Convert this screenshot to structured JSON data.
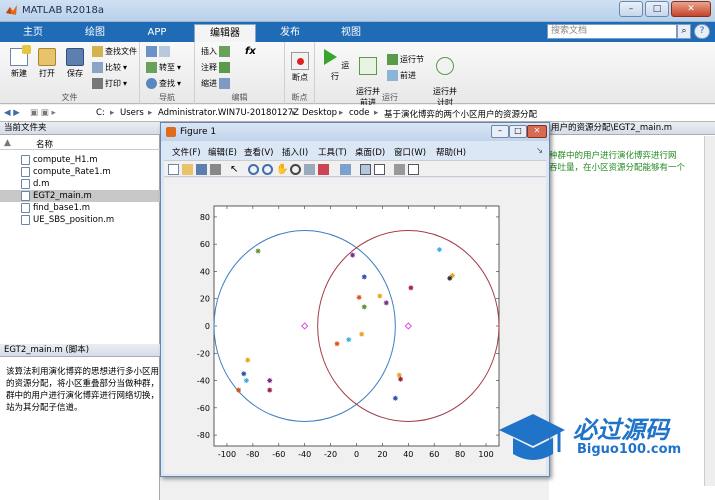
{
  "window": {
    "title": "MATLAB R2018a",
    "min": "–",
    "max": "□",
    "close": "✕"
  },
  "ribbon_tabs": [
    {
      "label": "主页"
    },
    {
      "label": "绘图"
    },
    {
      "label": "APP"
    },
    {
      "label": "编辑器"
    },
    {
      "label": "发布"
    },
    {
      "label": "视图"
    }
  ],
  "search": {
    "placeholder": "搜索文档",
    "help": "?"
  },
  "ribbon": {
    "file_group": {
      "label": "文件",
      "new": "新建",
      "open": "打开",
      "save": "保存",
      "find_files": "查找文件",
      "compare": "比较",
      "print": "打印"
    },
    "nav_group": {
      "label": "导航",
      "goto": "转至",
      "find": "查找"
    },
    "edit_group": {
      "label": "编辑",
      "insert": "插入",
      "comment": "注释",
      "indent": "缩进",
      "fx": "fx"
    },
    "breakpoint_group": {
      "label": "断点",
      "breakpoint": "断点"
    },
    "run_group": {
      "label": "运行",
      "run": "运行",
      "run_advance": "运行并\n前进",
      "run_section": "运行节",
      "advance": "前进",
      "run_time": "运行并\n计时"
    }
  },
  "address": {
    "path": [
      "C:",
      "Users",
      "Administrator.WIN7U-20180127Z",
      "Desktop",
      "code",
      "基于演化博弈的两个小区用户的资源分配"
    ]
  },
  "current_folder": {
    "header": "当前文件夹",
    "col_name": "名称",
    "sort": "▲",
    "files": [
      "compute_H1.m",
      "compute_Rate1.m",
      "d.m",
      "EGT2_main.m",
      "find_base1.m",
      "UE_SBS_position.m"
    ],
    "selected": "EGT2_main.m"
  },
  "details": {
    "header": "EGT2_main.m (脚本)",
    "text": [
      "该算法利用演化博弈的思想进行多小区用",
      "的资源分配，将小区重叠部分当做种群，",
      "群中的用户进行演化博弈进行网络切换，",
      "站为其分配子信道。"
    ]
  },
  "editor": {
    "tab": "用户的资源分配\\EGT2_main.m",
    "lines": [
      "种群中的用户进行演化博弈进行网",
      "吞吐量，在小区资源分配能够有一个"
    ]
  },
  "figure": {
    "title": "Figure 1",
    "menu": [
      "文件(F)",
      "编辑(E)",
      "查看(V)",
      "插入(I)",
      "工具(T)",
      "桌面(D)",
      "窗口(W)",
      "帮助(H)"
    ]
  },
  "chart_data": {
    "type": "scatter",
    "xlim": [
      -110,
      110
    ],
    "ylim": [
      -88,
      88
    ],
    "xticks": [
      -100,
      -80,
      -60,
      -40,
      -20,
      0,
      20,
      40,
      60,
      80,
      100
    ],
    "yticks": [
      80,
      60,
      40,
      20,
      0,
      -20,
      -40,
      -60,
      -80
    ],
    "circles": [
      {
        "cx": -40,
        "cy": 0,
        "r": 70,
        "color": "#3a7fc1"
      },
      {
        "cx": 40,
        "cy": 0,
        "r": 70,
        "color": "#a23b4a"
      }
    ],
    "centers": [
      {
        "x": -40,
        "y": 0,
        "color": "#e040e0"
      },
      {
        "x": 40,
        "y": 0,
        "color": "#e040e0"
      }
    ],
    "points": [
      {
        "x": -76,
        "y": 55,
        "color": "#5c8f2e"
      },
      {
        "x": -84,
        "y": -25,
        "color": "#e6a21f"
      },
      {
        "x": -87,
        "y": -35,
        "color": "#2850b0"
      },
      {
        "x": -85,
        "y": -40,
        "color": "#3db0e8"
      },
      {
        "x": -67,
        "y": -40,
        "color": "#7a2e8e"
      },
      {
        "x": -67,
        "y": -47,
        "color": "#a01f3a"
      },
      {
        "x": -91,
        "y": -47,
        "color": "#d9531e"
      },
      {
        "x": -3,
        "y": 52,
        "color": "#7a2e8e"
      },
      {
        "x": 6,
        "y": 36,
        "color": "#2850b0"
      },
      {
        "x": 2,
        "y": 21,
        "color": "#d9531e"
      },
      {
        "x": 6,
        "y": 14,
        "color": "#5c8f2e"
      },
      {
        "x": 18,
        "y": 22,
        "color": "#e6a21f"
      },
      {
        "x": 23,
        "y": 17,
        "color": "#7a2e8e"
      },
      {
        "x": 42,
        "y": 28,
        "color": "#a01f3a"
      },
      {
        "x": 64,
        "y": 56,
        "color": "#3db0e8"
      },
      {
        "x": 74,
        "y": 37,
        "color": "#e6a21f"
      },
      {
        "x": 72,
        "y": 35,
        "color": "#2a2a2a"
      },
      {
        "x": 4,
        "y": -6,
        "color": "#e6a21f"
      },
      {
        "x": -6,
        "y": -10,
        "color": "#3db0e8"
      },
      {
        "x": -15,
        "y": -13,
        "color": "#d9531e"
      },
      {
        "x": 33,
        "y": -36,
        "color": "#e6a21f"
      },
      {
        "x": 34,
        "y": -39,
        "color": "#a01f3a"
      },
      {
        "x": 30,
        "y": -53,
        "color": "#2850b0"
      }
    ]
  },
  "watermark": {
    "title": "必过源码",
    "url": "Biguo100.com"
  }
}
